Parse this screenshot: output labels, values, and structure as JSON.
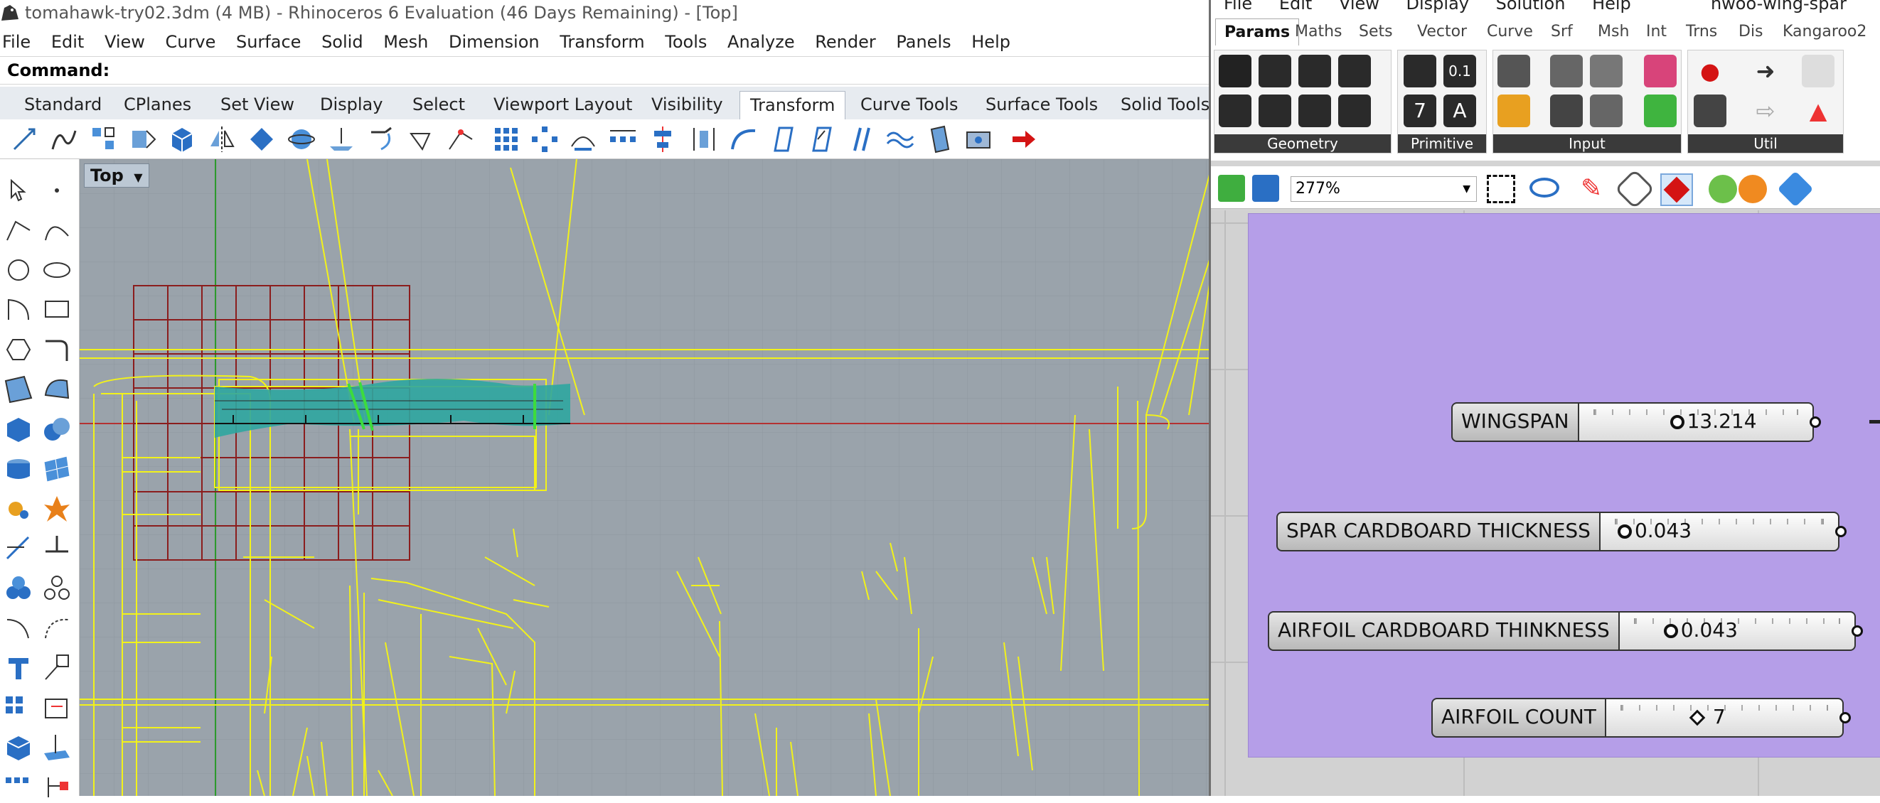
{
  "window": {
    "title": "tomahawk-try02.3dm (4 MB) - Rhinoceros 6 Evaluation (46 Days Remaining) - [Top]"
  },
  "menu": [
    "File",
    "Edit",
    "View",
    "Curve",
    "Surface",
    "Solid",
    "Mesh",
    "Dimension",
    "Transform",
    "Tools",
    "Analyze",
    "Render",
    "Panels",
    "Help"
  ],
  "command": {
    "label": "Command:"
  },
  "ribbon_tabs": [
    "Standard",
    "CPlanes",
    "Set View",
    "Display",
    "Select",
    "Viewport Layout",
    "Visibility",
    "Transform",
    "Curve Tools",
    "Surface Tools",
    "Solid Tools"
  ],
  "active_ribbon_tab": "Transform",
  "viewport": {
    "name": "Top",
    "dropdown_icon": "chevron-down-icon"
  },
  "grasshopper": {
    "menu": [
      "File",
      "Edit",
      "View",
      "Display",
      "Solution",
      "Help"
    ],
    "document_name": "hwoo-wing-spar",
    "tabs": [
      "Params",
      "Maths",
      "Sets",
      "Vector",
      "Curve",
      "Srf",
      "Msh",
      "Int",
      "Trns",
      "Dis",
      "Kangaroo2"
    ],
    "active_tab": "Params",
    "groups": [
      "Geometry",
      "Primitive",
      "Input",
      "Util"
    ],
    "zoom": "277%",
    "group_color": "#b59ee8",
    "sliders": [
      {
        "name": "WINGSPAN",
        "value": "13.214",
        "knob": "circle"
      },
      {
        "name": "SPAR CARDBOARD THICKNESS",
        "value": "0.043",
        "knob": "circle"
      },
      {
        "name": "AIRFOIL CARDBOARD THINKNESS",
        "value": "0.043",
        "knob": "circle"
      },
      {
        "name": "AIRFOIL COUNT",
        "value": "7",
        "knob": "diamond"
      }
    ]
  }
}
